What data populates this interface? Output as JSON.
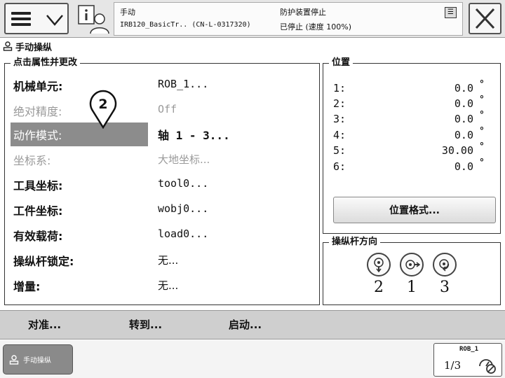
{
  "header": {
    "mode": "手动",
    "system_name": "IRB120_BasicTr..  (CN-L-0317320)",
    "safety_state": "防护装置停止",
    "run_state": "已停止 (速度 100%)"
  },
  "window": {
    "title": "手动操纵"
  },
  "properties": {
    "title": "点击属性并更改",
    "rows": [
      {
        "label": "机械单元:",
        "value": "ROB_1..."
      },
      {
        "label": "绝对精度:",
        "value": "Off"
      },
      {
        "label": "动作模式:",
        "value": "轴 1 - 3..."
      },
      {
        "label": "坐标系:",
        "value": "大地坐标..."
      },
      {
        "label": "工具坐标:",
        "value": "tool0..."
      },
      {
        "label": "工件坐标:",
        "value": "wobj0..."
      },
      {
        "label": "有效载荷:",
        "value": "load0..."
      },
      {
        "label": "操纵杆锁定:",
        "value": "无..."
      },
      {
        "label": "增量:",
        "value": "无..."
      }
    ],
    "selected_index": 2,
    "disabled_indices": [
      1,
      3
    ],
    "callout_number": "2"
  },
  "position": {
    "title": "位置",
    "unit": "°",
    "rows": [
      {
        "key": "1:",
        "value": "0.0"
      },
      {
        "key": "2:",
        "value": "0.0"
      },
      {
        "key": "3:",
        "value": "0.0"
      },
      {
        "key": "4:",
        "value": "0.0"
      },
      {
        "key": "5:",
        "value": "30.00"
      },
      {
        "key": "6:",
        "value": "0.0"
      }
    ],
    "format_button": "位置格式..."
  },
  "joystick": {
    "title": "操纵杆方向",
    "axes": [
      {
        "number": "2",
        "icon": "vertical-axis-icon"
      },
      {
        "number": "1",
        "icon": "horizontal-axis-icon"
      },
      {
        "number": "3",
        "icon": "rotation-axis-icon"
      }
    ]
  },
  "actions": {
    "align": "对准...",
    "goto": "转到...",
    "start": "启动..."
  },
  "taskbar": {
    "task_label": "手动操纵"
  },
  "robot_status": {
    "unit": "ROB_1",
    "fraction": "1/3"
  }
}
